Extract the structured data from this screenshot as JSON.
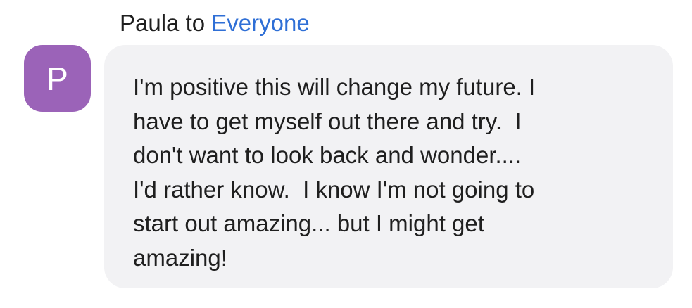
{
  "chat_message": {
    "sender": "Paula",
    "connector": "to",
    "recipient": "Everyone",
    "avatar": {
      "initial": "P",
      "color": "#9b63b8"
    },
    "text": "I'm positive this will change my future. I\nhave to get myself out there and try.  I\ndon't want to look back and wonder....\nI'd rather know.  I know I'm not going to\nstart out amazing... but I might get\namazing!"
  },
  "colors": {
    "recipient_link": "#2f6fd6",
    "bubble_background": "#f2f2f4",
    "text": "#1f1f1f"
  }
}
